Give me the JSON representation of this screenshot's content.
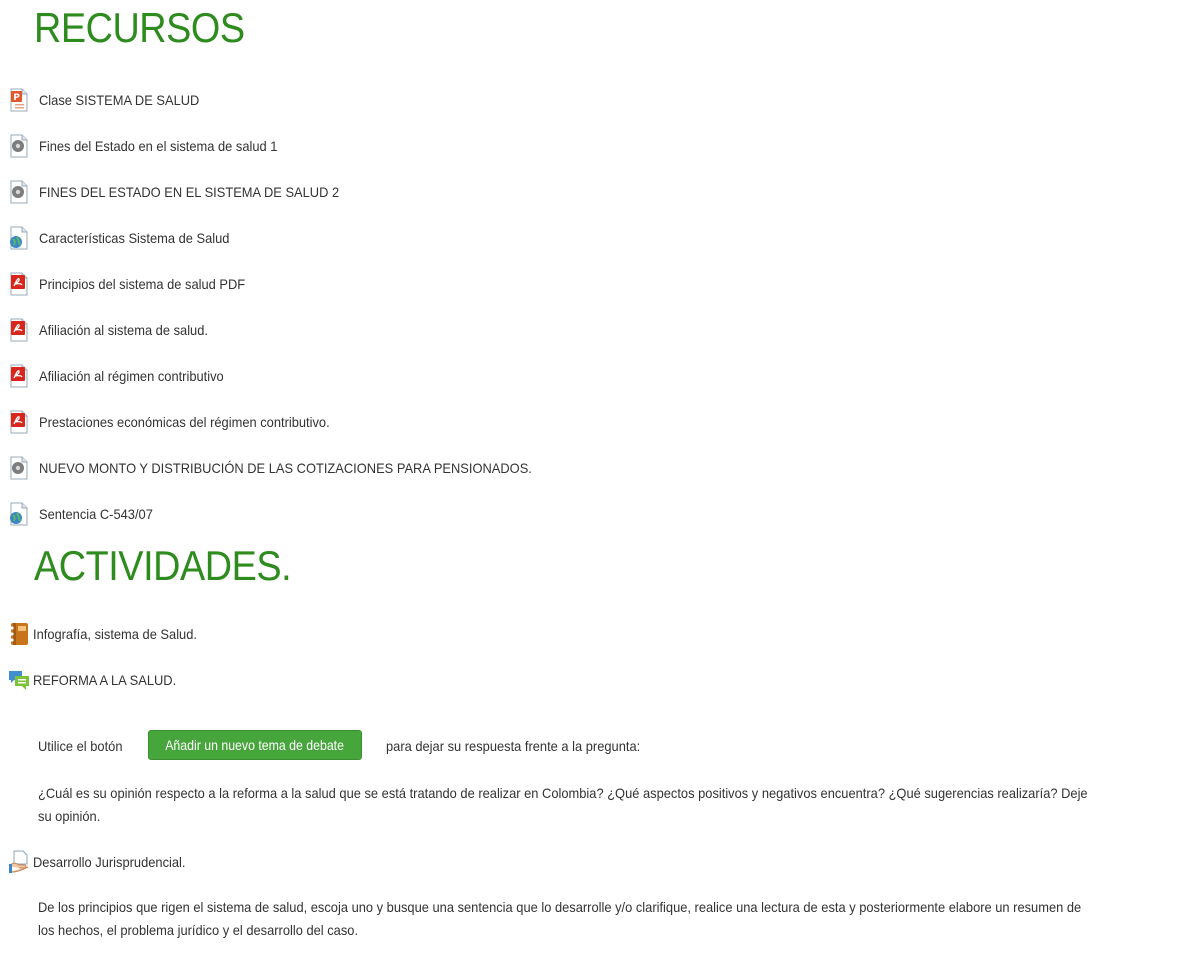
{
  "recursos": {
    "title": "RECURSOS",
    "items": [
      {
        "label": "Clase SISTEMA DE SALUD",
        "icon": "powerpoint-icon"
      },
      {
        "label": "Fines del Estado en el sistema de salud 1",
        "icon": "video-icon"
      },
      {
        "label": "FINES DEL ESTADO EN EL SISTEMA DE SALUD 2",
        "icon": "video-icon"
      },
      {
        "label": "Características Sistema de Salud",
        "icon": "url-icon"
      },
      {
        "label": "Principios del sistema de salud PDF",
        "icon": "pdf-icon"
      },
      {
        "label": "Afiliación al sistema de salud.",
        "icon": "pdf-icon"
      },
      {
        "label": "Afiliación al régimen contributivo",
        "icon": "pdf-icon"
      },
      {
        "label": "Prestaciones económicas del régimen contributivo.",
        "icon": "pdf-icon"
      },
      {
        "label": "NUEVO MONTO Y DISTRIBUCIÓN DE LAS COTIZACIONES PARA PENSIONADOS.",
        "icon": "video-icon"
      },
      {
        "label": "Sentencia C-543/07",
        "icon": "url-icon"
      }
    ]
  },
  "actividades": {
    "title": "ACTIVIDADES.",
    "infografia": {
      "label": "Infografía, sistema de Salud.",
      "icon": "journal-icon"
    },
    "reforma": {
      "label": "REFORMA A LA SALUD.",
      "icon": "forum-icon",
      "instr_before": "Utilice el botón",
      "button_label": "Añadir un nuevo tema de debate",
      "instr_after": "para dejar su respuesta frente a la pregunta:",
      "question_line1": "¿Cuál es su opinión respecto a la reforma a la salud que se está tratando de realizar en Colombia? ¿Qué aspectos positivos y negativos encuentra? ¿Qué sugerencias realizaría?  Deje",
      "question_line2": "su opinión."
    },
    "desarrollo": {
      "label": "Desarrollo Jurisprudencial.",
      "icon": "assignment-icon",
      "desc_line1": "De los principios que rigen el sistema de salud, escoja uno y busque una sentencia que lo desarrolle y/o clarifique, realice una lectura de esta y posteriormente elabore un resumen de",
      "desc_line2": "los hechos, el problema jurídico y el desarrollo del caso."
    }
  },
  "colors": {
    "heading": "#2e8b1e",
    "button": "#47a63b",
    "text": "#333333"
  }
}
